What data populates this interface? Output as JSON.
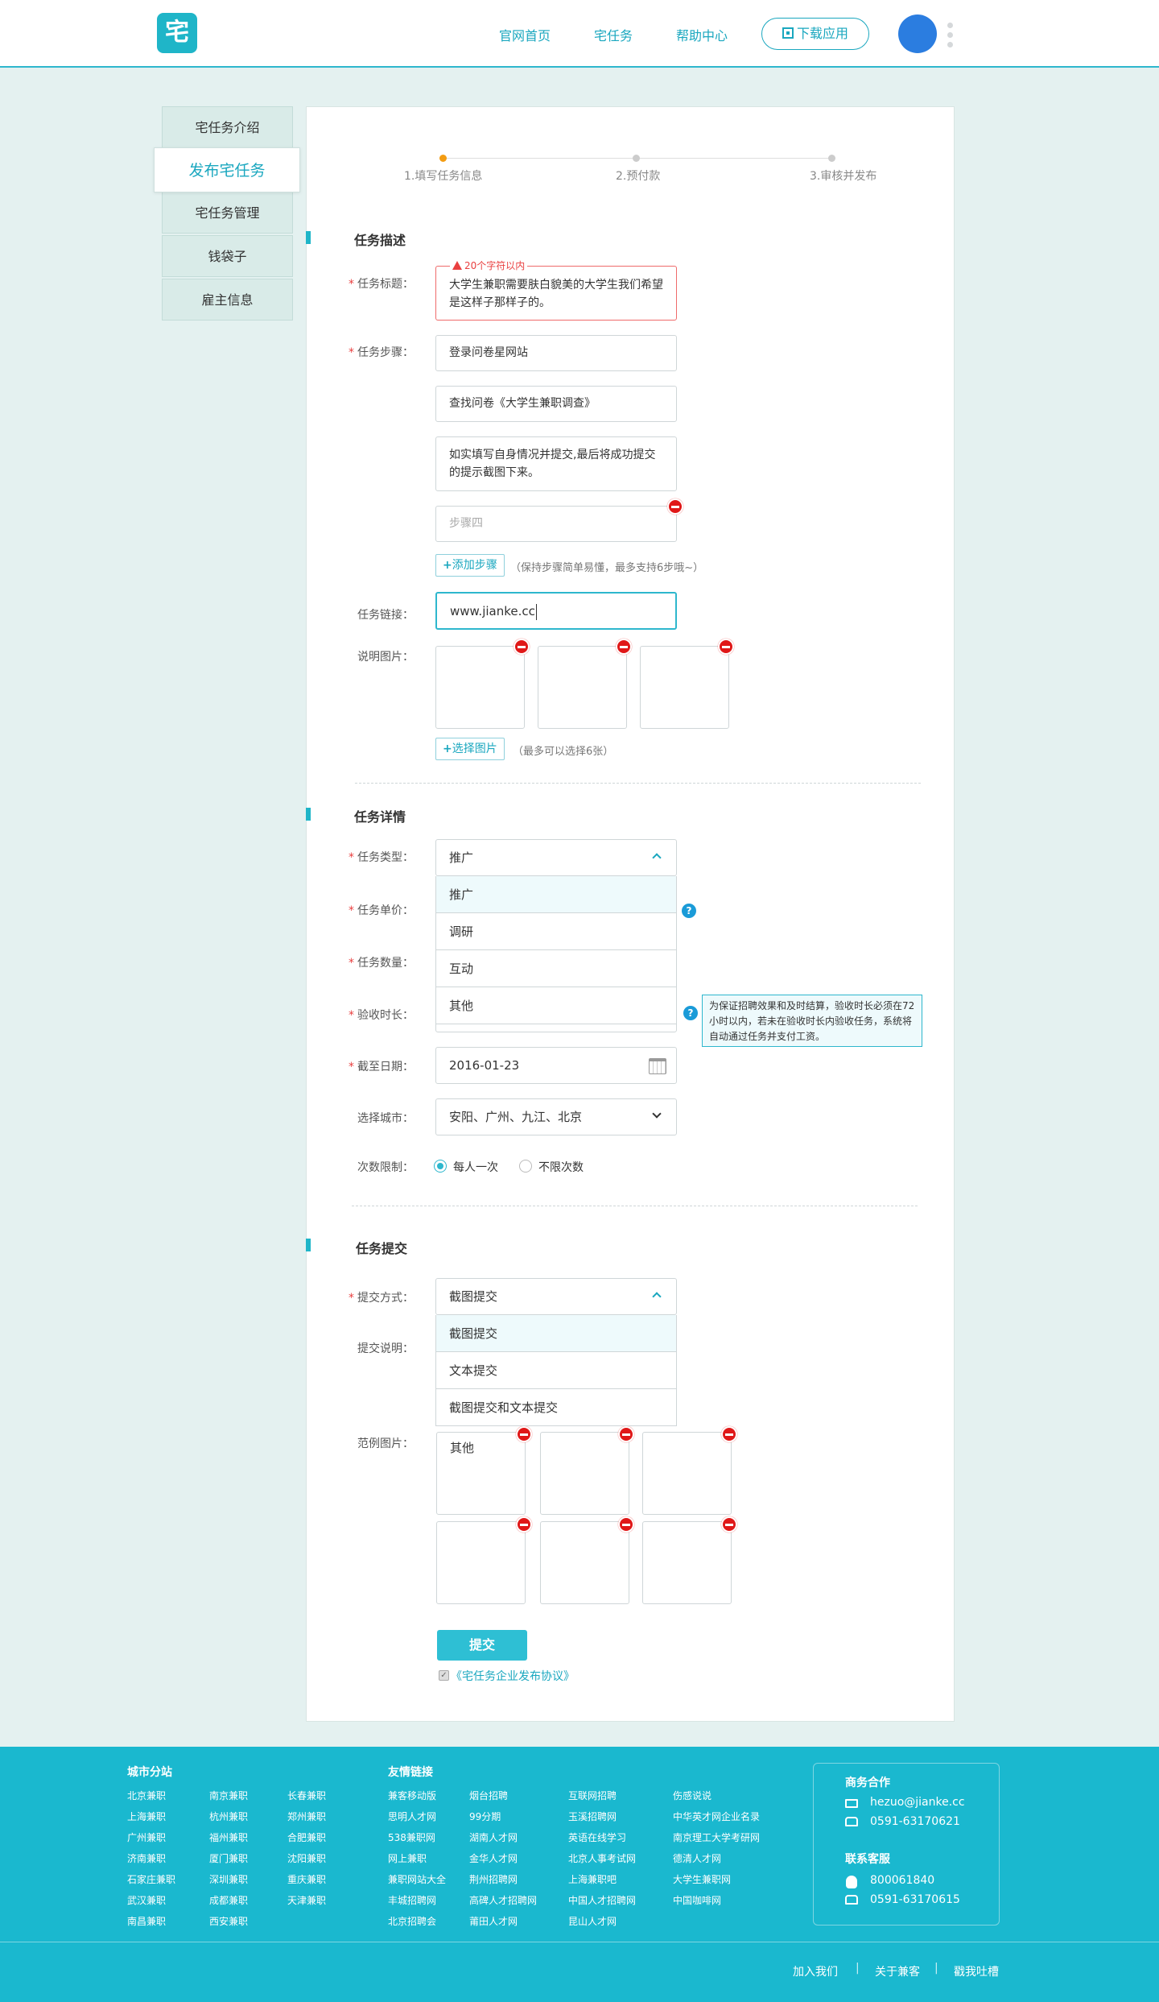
{
  "header": {
    "logo_glyph": "宅",
    "nav": [
      "官网首页",
      "宅任务",
      "帮助中心"
    ],
    "download_label": "下载应用"
  },
  "sidebar": {
    "items": [
      "宅任务介绍",
      "发布宅任务",
      "宅任务管理",
      "钱袋子",
      "雇主信息"
    ],
    "active_index": 1
  },
  "steps": {
    "items": [
      "1.填写任务信息",
      "2.预付款",
      "3.审核并发布"
    ],
    "current": 1
  },
  "section_desc": {
    "title": "任务描述",
    "title_label": "任务标题：",
    "title_error": "20个字符以内",
    "title_value": "大学生兼职需要肤白貌美的大学生我们希望是这样子那样子的。",
    "steps_label": "任务步骤：",
    "step_values": [
      "登录问卷星网站",
      "查找问卷《大学生兼职调查》",
      "如实填写自身情况并提交,最后将成功提交的提示截图下来。"
    ],
    "step4_placeholder": "步骤四",
    "add_step": "添加步骤",
    "add_step_hint": "（保持步骤简单易懂，最多支持6步哦~）",
    "link_label": "任务链接：",
    "link_value": "www.jianke.cc",
    "images_label": "说明图片：",
    "choose_images": "选择图片",
    "choose_images_hint": "（最多可以选择6张）"
  },
  "section_detail": {
    "title": "任务详情",
    "type_label": "任务类型：",
    "type_value": "推广",
    "type_options": [
      "推广",
      "调研",
      "互动",
      "其他"
    ],
    "price_label": "任务单价：",
    "count_label": "任务数量：",
    "duration_label": "验收时长：",
    "duration_tip": "为保证招聘效果和及时结算，验收时长必须在72小时以内，若未在验收时长内验收任务，系统将自动通过任务并支付工资。",
    "deadline_label": "截至日期：",
    "deadline_value": "2016-01-23",
    "city_label": "选择城市：",
    "city_value": "安阳、广州、九江、北京",
    "limit_label": "次数限制：",
    "limit_options": [
      "每人一次",
      "不限次数"
    ],
    "limit_selected": 0
  },
  "section_submit": {
    "title": "任务提交",
    "method_label": "提交方式：",
    "method_value": "截图提交",
    "method_options": [
      "截图提交",
      "文本提交",
      "截图提交和文本提交"
    ],
    "desc_label": "提交说明：",
    "example_label": "范例图片：",
    "example_first_text": "其他",
    "submit_label": "提交",
    "agreement": "《宅任务企业发布协议》",
    "agreement_checked": true
  },
  "footer": {
    "city_title": "城市分站",
    "cities": [
      [
        "北京兼职",
        "南京兼职",
        "长春兼职"
      ],
      [
        "上海兼职",
        "杭州兼职",
        "郑州兼职"
      ],
      [
        "广州兼职",
        "福州兼职",
        "合肥兼职"
      ],
      [
        "济南兼职",
        "厦门兼职",
        "沈阳兼职"
      ],
      [
        "石家庄兼职",
        "深圳兼职",
        "重庆兼职"
      ],
      [
        "武汉兼职",
        "成都兼职",
        "天津兼职"
      ],
      [
        "南昌兼职",
        "西安兼职",
        ""
      ]
    ],
    "links_title": "友情链接",
    "links": [
      [
        "兼客移动版",
        "烟台招聘",
        "互联网招聘",
        "伤感说说"
      ],
      [
        "思明人才网",
        "99分期",
        "玉溪招聘网",
        "中华英才网企业名录"
      ],
      [
        "538兼职网",
        "湖南人才网",
        "英语在线学习",
        "南京理工大学考研网"
      ],
      [
        "网上兼职",
        "金华人才网",
        "北京人事考试网",
        "德清人才网"
      ],
      [
        "兼职网站大全",
        "荆州招聘网",
        "上海兼职吧",
        "大学生兼职网"
      ],
      [
        "丰城招聘网",
        "高碑人才招聘网",
        "中国人才招聘网",
        "中国咖啡网"
      ],
      [
        "北京招聘会",
        "莆田人才网",
        "昆山人才网",
        ""
      ]
    ],
    "biz_title": "商务合作",
    "biz_email": "hezuo@jianke.cc",
    "biz_phone": "0591-63170621",
    "service_title": "联系客服",
    "service_qq": "800061840",
    "service_phone": "0591-63170615",
    "bottom_links": [
      "加入我们",
      "关于兼客",
      "戳我吐槽"
    ]
  },
  "colors": {
    "accent": "#1fb5c8",
    "link": "#1aa7bf",
    "error": "#e94040",
    "step_current": "#f39c12"
  }
}
